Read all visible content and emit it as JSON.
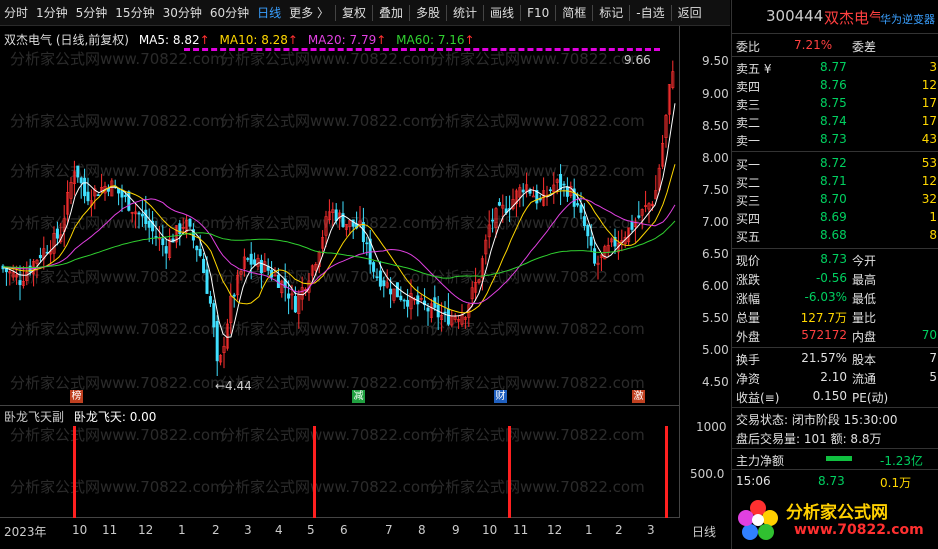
{
  "toolbar": {
    "periods": [
      "分时",
      "1分钟",
      "5分钟",
      "15分钟",
      "30分钟",
      "60分钟",
      "日线",
      "更多 〉"
    ],
    "active_period": "日线",
    "tools": [
      "复权",
      "叠加",
      "多股",
      "统计",
      "画线",
      "F10",
      "简框",
      "标记",
      "-自选",
      "返回"
    ]
  },
  "chart_header": {
    "name": "双杰电气 (日线,前复权)",
    "ma5_label": "MA5: 8.82",
    "ma10_label": "MA10: 8.28",
    "ma20_label": "MA20: 7.79",
    "ma60_label": "MA60: 7.16",
    "arrow": "↑"
  },
  "price_axis": [
    "9.50",
    "9.00",
    "8.50",
    "8.00",
    "7.50",
    "7.00",
    "6.50",
    "6.00",
    "5.50",
    "5.00",
    "4.50"
  ],
  "high_annotation": "9.66",
  "low_annotation": "←4.44",
  "markers": [
    {
      "label": "榜",
      "color": "#c04020"
    },
    {
      "label": "减",
      "color": "#20a040"
    },
    {
      "label": "财",
      "color": "#2060c0"
    },
    {
      "label": "激",
      "color": "#c04020"
    }
  ],
  "indicator": {
    "title": "卧龙飞天副",
    "value_label": "卧龙飞天: 0.00",
    "axis": [
      "1000",
      "500.0"
    ],
    "bars_at_month_index": [
      0,
      6,
      12,
      19
    ]
  },
  "date_axis": [
    "2023年",
    "10",
    "11",
    "12",
    "1",
    "2",
    "3",
    "4",
    "5",
    "6",
    "7",
    "8",
    "9",
    "10",
    "11",
    "12",
    "1",
    "2",
    "3"
  ],
  "date_axis_right": "日线",
  "watermark": "分析家公式网www.70822.com",
  "quote": {
    "code": "300444",
    "name": "双杰电气",
    "badge": "华为逆变器",
    "webi_label": "委比",
    "webi_value": "7.21%",
    "weicha_label": "委差",
    "sells": [
      {
        "label": "卖五 ¥",
        "price": "8.77",
        "vol": "3"
      },
      {
        "label": "卖四",
        "price": "8.76",
        "vol": "12"
      },
      {
        "label": "卖三",
        "price": "8.75",
        "vol": "17"
      },
      {
        "label": "卖二",
        "price": "8.74",
        "vol": "17"
      },
      {
        "label": "卖一",
        "price": "8.73",
        "vol": "43"
      }
    ],
    "buys": [
      {
        "label": "买一",
        "price": "8.72",
        "vol": "53"
      },
      {
        "label": "买二",
        "price": "8.71",
        "vol": "12"
      },
      {
        "label": "买三",
        "price": "8.70",
        "vol": "32"
      },
      {
        "label": "买四",
        "price": "8.69",
        "vol": "1"
      },
      {
        "label": "买五",
        "price": "8.68",
        "vol": "8"
      }
    ],
    "stats": [
      {
        "l1": "现价",
        "v1": "8.73",
        "c1": "green",
        "l2": "今开",
        "v2": "",
        "c2": "white"
      },
      {
        "l1": "涨跌",
        "v1": "-0.56",
        "c1": "green",
        "l2": "最高",
        "v2": "",
        "c2": "white"
      },
      {
        "l1": "涨幅",
        "v1": "-6.03%",
        "c1": "green",
        "l2": "最低",
        "v2": "",
        "c2": "white"
      },
      {
        "l1": "总量",
        "v1": "127.7万",
        "c1": "yellow",
        "l2": "量比",
        "v2": "",
        "c2": "white"
      },
      {
        "l1": "外盘",
        "v1": "572172",
        "c1": "red",
        "l2": "内盘",
        "v2": "70",
        "c2": "green"
      }
    ],
    "stats2": [
      {
        "l1": "换手",
        "v1": "21.57%",
        "l2": "股本",
        "v2": "7"
      },
      {
        "l1": "净资",
        "v1": "2.10",
        "l2": "流通",
        "v2": "5"
      },
      {
        "l1": "收益(≡)",
        "v1": "0.150",
        "l2": "PE(动)",
        "v2": ""
      }
    ],
    "trade_status": "交易状态: 闭市阶段 15:30:00",
    "after_hours": "盘后交易量: 101  额: 8.8万",
    "main_net_label": "主力净额",
    "main_net_value": "-1.23亿",
    "tick": {
      "time": "15:06",
      "price": "8.73",
      "vol": "0.1万"
    }
  },
  "logo": {
    "text": "分析家公式网",
    "url": "www.70822.com"
  }
}
